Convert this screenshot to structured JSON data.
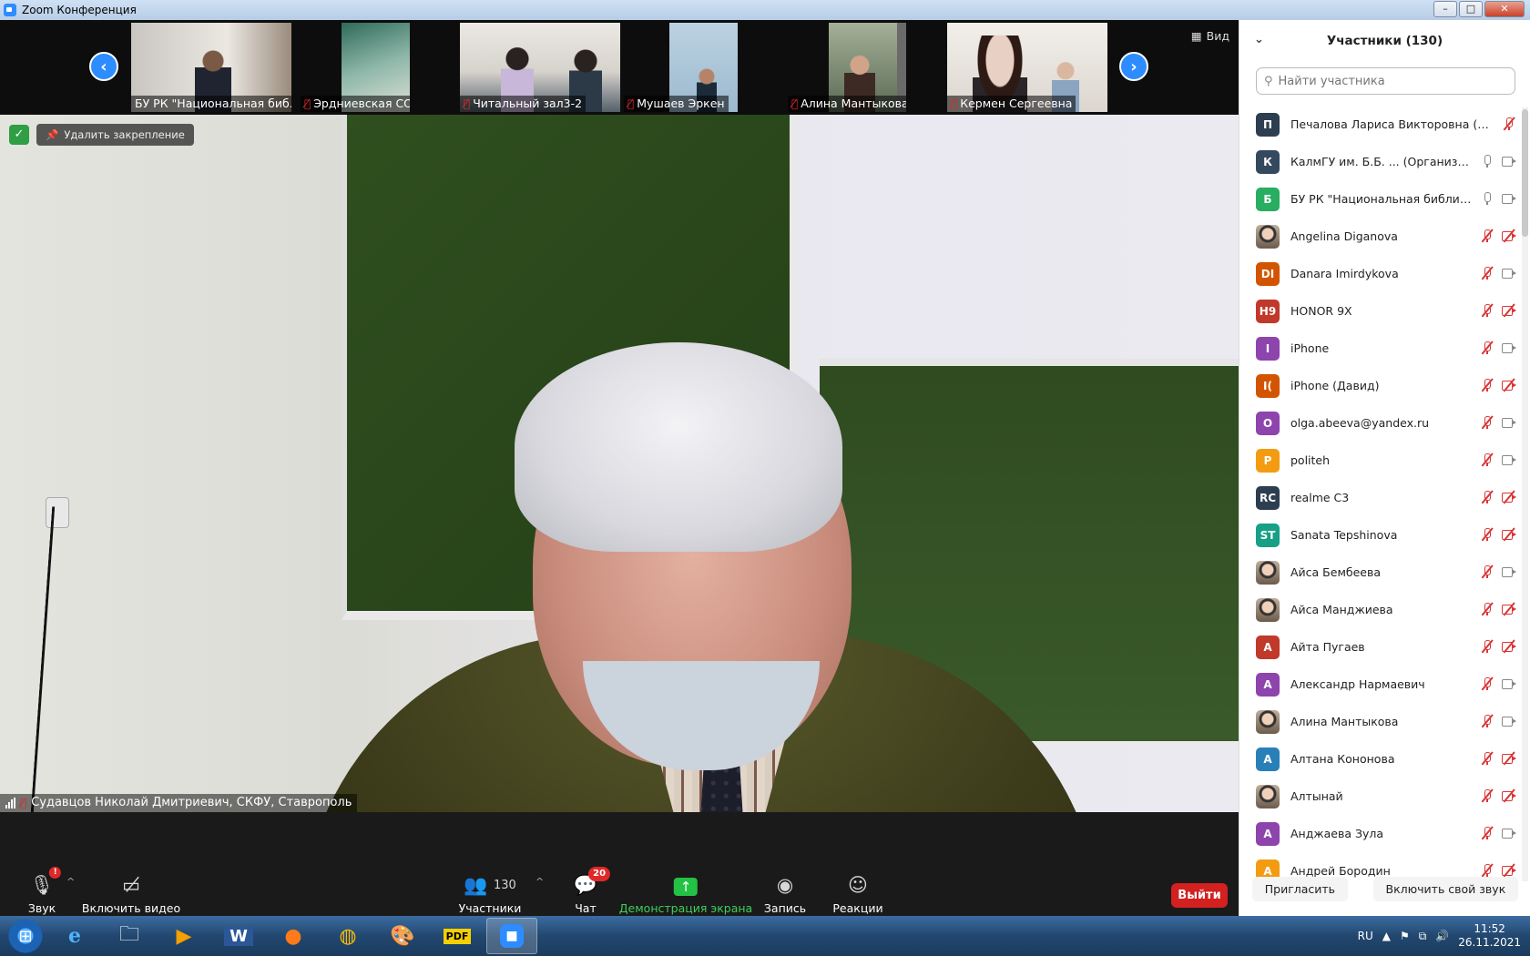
{
  "window": {
    "title": "Zoom Конференция"
  },
  "gallery": {
    "view_label": "Вид",
    "thumbnails": [
      {
        "name": "БУ РК \"Национальная биб...",
        "muted": false
      },
      {
        "name": "Эрдниевская СОШ",
        "muted": true
      },
      {
        "name": "Читальный зал3-2",
        "muted": true
      },
      {
        "name": "Мушаев Эркен",
        "muted": true
      },
      {
        "name": "Алина Мантыкова",
        "muted": true
      },
      {
        "name": "Кермен Сергеевна",
        "muted": true
      }
    ]
  },
  "main_video": {
    "unpin_label": "Удалить закрепление",
    "speaker_name": "Судавцов Николай Дмитриевич, СКФУ, Ставрополь"
  },
  "controls": {
    "audio_label": "Звук",
    "audio_badge": "!",
    "video_label": "Включить видео",
    "participants_label": "Участники",
    "participants_count": "130",
    "chat_label": "Чат",
    "chat_badge": "20",
    "share_label": "Демонстрация экрана",
    "record_label": "Запись",
    "reactions_label": "Реакции",
    "exit_label": "Выйти"
  },
  "panel": {
    "title": "Участники (130)",
    "search_placeholder": "Найти участника",
    "invite_label": "Пригласить",
    "unmute_label": "Включить свой звук",
    "participants": [
      {
        "initials": "П",
        "color": "#2c3e50",
        "name": "Печалова Лариса Викторовна (... (Я)",
        "mic": "off",
        "cam": "none"
      },
      {
        "initials": "К",
        "color": "#34495e",
        "name": "КалмГУ им. Б.Б. ... (Организатор)",
        "mic": "on",
        "cam": "on"
      },
      {
        "initials": "Б",
        "color": "#27ae60",
        "name": "БУ РК \"Национальная библиот...",
        "mic": "on",
        "cam": "on"
      },
      {
        "initials": "",
        "color": "photo",
        "name": "Angelina Diganova",
        "mic": "off",
        "cam": "off"
      },
      {
        "initials": "DI",
        "color": "#d35400",
        "name": "Danara Imirdykova",
        "mic": "off",
        "cam": "on"
      },
      {
        "initials": "H9",
        "color": "#c0392b",
        "name": "HONOR 9X",
        "mic": "off",
        "cam": "off"
      },
      {
        "initials": "I",
        "color": "#8e44ad",
        "name": "iPhone",
        "mic": "off",
        "cam": "on"
      },
      {
        "initials": "I(",
        "color": "#d35400",
        "name": "iPhone (Давид)",
        "mic": "off",
        "cam": "off"
      },
      {
        "initials": "O",
        "color": "#8e44ad",
        "name": "olga.abeeva@yandex.ru",
        "mic": "off",
        "cam": "on"
      },
      {
        "initials": "P",
        "color": "#f39c12",
        "name": "politeh",
        "mic": "off",
        "cam": "on"
      },
      {
        "initials": "RC",
        "color": "#2c3e50",
        "name": "realme C3",
        "mic": "off",
        "cam": "off"
      },
      {
        "initials": "ST",
        "color": "#16a085",
        "name": "Sanata Tepshinova",
        "mic": "off",
        "cam": "off"
      },
      {
        "initials": "",
        "color": "photo",
        "name": "Айса Бембеева",
        "mic": "off",
        "cam": "on"
      },
      {
        "initials": "",
        "color": "photo",
        "name": "Айса Манджиева",
        "mic": "off",
        "cam": "off"
      },
      {
        "initials": "А",
        "color": "#c0392b",
        "name": "Айта Пугаев",
        "mic": "off",
        "cam": "off"
      },
      {
        "initials": "А",
        "color": "#8e44ad",
        "name": "Александр Нармаевич",
        "mic": "off",
        "cam": "on"
      },
      {
        "initials": "",
        "color": "photo",
        "name": "Алина Мантыкова",
        "mic": "off",
        "cam": "on"
      },
      {
        "initials": "А",
        "color": "#2980b9",
        "name": "Алтана Кононова",
        "mic": "off",
        "cam": "off"
      },
      {
        "initials": "",
        "color": "photo",
        "name": "Алтынай",
        "mic": "off",
        "cam": "off"
      },
      {
        "initials": "А",
        "color": "#8e44ad",
        "name": "Анджаева Зула",
        "mic": "off",
        "cam": "on"
      },
      {
        "initials": "А",
        "color": "#f39c12",
        "name": "Андрей Бородин",
        "mic": "off",
        "cam": "off"
      }
    ]
  },
  "taskbar": {
    "language": "RU",
    "time": "11:52",
    "date": "26.11.2021"
  }
}
